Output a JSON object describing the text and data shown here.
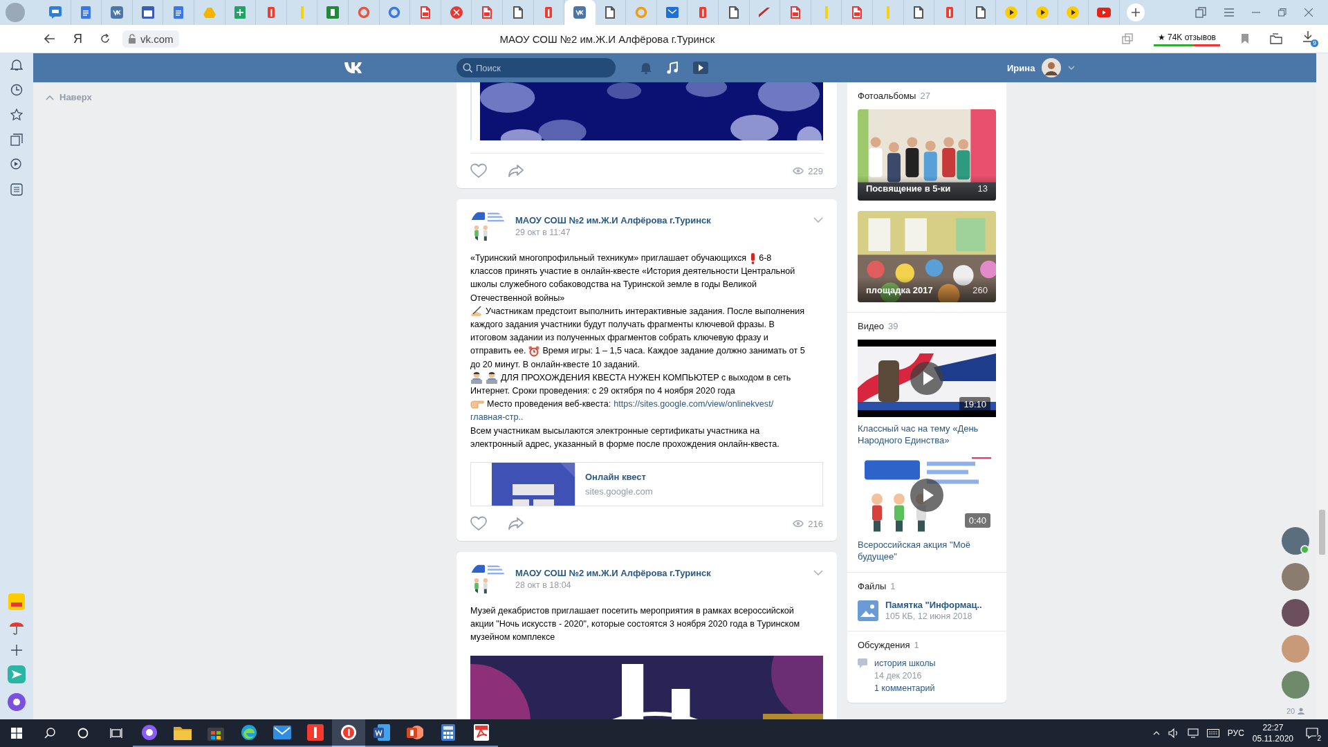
{
  "browser": {
    "tabs": [
      {
        "kind": "chat",
        "color": "#2a7de1",
        "selected": false
      },
      {
        "kind": "doc",
        "color": "#3b78e7",
        "selected": false
      },
      {
        "kind": "vk",
        "color": "#4a76a8",
        "selected": false
      },
      {
        "kind": "calendar",
        "color": "#3b5bb5",
        "selected": false
      },
      {
        "kind": "doc",
        "color": "#3b78e7",
        "selected": false
      },
      {
        "kind": "drive",
        "color": "#f4b400",
        "selected": false
      },
      {
        "kind": "sheet",
        "color": "#1fa463",
        "selected": false
      },
      {
        "kind": "yandex",
        "color": "#f33a2f",
        "selected": false
      },
      {
        "kind": "bar",
        "color": "#f5d10f",
        "selected": false
      },
      {
        "kind": "square",
        "color": "#1f8a3a",
        "selected": false
      },
      {
        "kind": "ring",
        "color": "#e8543c",
        "selected": false
      },
      {
        "kind": "ring",
        "color": "#3b78e7",
        "selected": false
      },
      {
        "kind": "pdf",
        "color": "#e53935",
        "selected": false
      },
      {
        "kind": "circle",
        "color": "#e53935",
        "selected": false
      },
      {
        "kind": "pdf",
        "color": "#e53935",
        "selected": false
      },
      {
        "kind": "page",
        "color": "#555555",
        "selected": false
      },
      {
        "kind": "yandex",
        "color": "#f33a2f",
        "selected": false
      },
      {
        "kind": "vk",
        "color": "#4a76a8",
        "selected": true
      },
      {
        "kind": "page",
        "color": "#555555",
        "selected": false
      },
      {
        "kind": "ring",
        "color": "#f39c12",
        "selected": false
      },
      {
        "kind": "mail",
        "color": "#1e6fd9",
        "selected": false
      },
      {
        "kind": "yandex",
        "color": "#f33a2f",
        "selected": false
      },
      {
        "kind": "page",
        "color": "#555555",
        "selected": false
      },
      {
        "kind": "slash",
        "color": "#c62828",
        "selected": false
      },
      {
        "kind": "pdf",
        "color": "#e53935",
        "selected": false
      },
      {
        "kind": "bar",
        "color": "#f5d10f",
        "selected": false
      },
      {
        "kind": "pdf",
        "color": "#e53935",
        "selected": false
      },
      {
        "kind": "bar",
        "color": "#f5d10f",
        "selected": false
      },
      {
        "kind": "page",
        "color": "#555555",
        "selected": false
      },
      {
        "kind": "yandex",
        "color": "#f33a2f",
        "selected": false
      },
      {
        "kind": "page",
        "color": "#555555",
        "selected": false
      },
      {
        "kind": "play",
        "color": "#ffcc00",
        "selected": false
      },
      {
        "kind": "play",
        "color": "#ffcc00",
        "selected": false
      },
      {
        "kind": "play",
        "color": "#ffcc00",
        "selected": false
      },
      {
        "kind": "youtube",
        "color": "#e62117",
        "selected": false
      }
    ],
    "address": "vk.com",
    "page_title": "МАОУ СОШ №2 им.Ж.И Алфёрова г.Туринск",
    "yandex_button": "Я",
    "reviews": "★ 74K отзывов",
    "downloads_badge": "9"
  },
  "vk_header": {
    "search_placeholder": "Поиск",
    "user_name": "Ирина"
  },
  "back_to_top": "Наверх",
  "posts": [
    {
      "kind": "partial",
      "attachment": {
        "kind": "picture"
      },
      "views": "229"
    },
    {
      "kind": "full",
      "author": "МАОУ СОШ №2 им.Ж.И Алфёрова г.Туринск",
      "date": "29 окт в 11:47",
      "lines": [
        [
          {
            "kind": "text",
            "text": "«Туринский многопрофильный техникум» приглашает обучающихся"
          },
          {
            "kind": "exclaim"
          },
          {
            "kind": "text",
            "text": "6-8"
          }
        ],
        [
          {
            "kind": "text",
            "text": "классов принять участие в онлайн-квесте «История деятельности Центральной"
          }
        ],
        [
          {
            "kind": "text",
            "text": "школы служебного собаководства на Туринской земле в годы Великой"
          }
        ],
        [
          {
            "kind": "text",
            "text": "Отечественной войны»"
          }
        ],
        [
          {
            "kind": "pen"
          },
          {
            "kind": "text",
            "text": "Участникам предстоит выполнить интерактивные задания. После выполнения"
          }
        ],
        [
          {
            "kind": "text",
            "text": "каждого задания участники будут получать фрагменты ключевой фразы. В"
          }
        ],
        [
          {
            "kind": "text",
            "text": "итоговом задании из полученных фрагментов собрать ключевую фразу и"
          }
        ],
        [
          {
            "kind": "text",
            "text": "отправить ее."
          },
          {
            "kind": "clock"
          },
          {
            "kind": "text",
            "text": "Время игры: 1 – 1,5 часа. Каждое задание должно занимать от 5"
          }
        ],
        [
          {
            "kind": "text",
            "text": "до 20 минут. В онлайн-квесте 10 заданий."
          }
        ],
        [
          {
            "kind": "coder"
          },
          {
            "kind": "coder"
          },
          {
            "kind": "text",
            "text": "ДЛЯ ПРОХОЖДЕНИЯ КВЕСТА НУЖЕН КОМПЬЮТЕР с выходом в сеть"
          }
        ],
        [
          {
            "kind": "text",
            "text": "Интернет. Сроки проведения: с 29 октября по 4 ноября 2020 года"
          }
        ],
        [
          {
            "kind": "point"
          },
          {
            "kind": "text",
            "text": "Место проведения веб-квеста:"
          },
          {
            "kind": "link",
            "text": "https://sites.google.com/view/onlinekvest/"
          }
        ],
        [
          {
            "kind": "link",
            "text": "главная-стр.."
          }
        ],
        [
          {
            "kind": "text",
            "text": "Всем участникам высылаются электронные сертификаты участника на"
          }
        ],
        [
          {
            "kind": "text",
            "text": "электронный адрес, указанный в форме после прохождения онлайн-квеста."
          }
        ]
      ],
      "link_card": {
        "title": "Онлайн квест",
        "domain": "sites.google.com"
      },
      "views": "216"
    },
    {
      "kind": "full",
      "author": "МАОУ СОШ №2 им.Ж.И Алфёрова г.Туринск",
      "date": "28 окт в 18:04",
      "lines": [
        [
          {
            "kind": "text",
            "text": "Музей декабристов приглашает посетить мероприятия в рамках всероссийской"
          }
        ],
        [
          {
            "kind": "text",
            "text": "акции \"Ночь искусств - 2020\", которые состоятся 3 ноября 2020 года в Туринском"
          }
        ],
        [
          {
            "kind": "text",
            "text": "музейном комплексе"
          }
        ]
      ],
      "attachment": {
        "kind": "picture"
      }
    }
  ],
  "sidebar": {
    "albums": {
      "title": "Фотоальбомы",
      "count": "27",
      "items": [
        {
          "title": "Посвящение в 5-ки",
          "count": "13"
        },
        {
          "title": "площадка 2017",
          "count": "260"
        }
      ]
    },
    "videos": {
      "title": "Видео",
      "count": "39",
      "items": [
        {
          "duration": "19:10",
          "title": "Классный час на тему «День Народного Единства»"
        },
        {
          "duration": "0:40",
          "title": "Всероссийская акция \"Моё будущее\""
        }
      ]
    },
    "files": {
      "title": "Файлы",
      "count": "1",
      "items": [
        {
          "name": "Памятка \"Информац..",
          "meta": "105 КБ, 12 июня 2018"
        }
      ]
    },
    "discussions": {
      "title": "Обсуждения",
      "count": "1",
      "items": [
        {
          "title": "история школы",
          "date": "14 дек 2016",
          "comments": "1 комментарий"
        }
      ]
    }
  },
  "online_friends": {
    "friends": [
      {
        "online": true
      },
      {
        "online": false
      },
      {
        "online": false
      },
      {
        "online": false
      },
      {
        "online": false
      }
    ],
    "count": "20"
  },
  "taskbar": {
    "apps": [
      {
        "kind": "alice",
        "color": "#8b5cf6",
        "selected": false
      },
      {
        "kind": "folder",
        "color": "#f4c542",
        "selected": false
      },
      {
        "kind": "store",
        "color": "#3f3f46",
        "selected": false
      },
      {
        "kind": "edge",
        "color": "#1fa0d8",
        "selected": false
      },
      {
        "kind": "mail",
        "color": "#2f8ee0",
        "selected": false
      },
      {
        "kind": "yandex",
        "color": "#f33a2f",
        "selected": false
      },
      {
        "kind": "ybrowser",
        "color": "#f33a2f",
        "selected": true
      },
      {
        "kind": "word",
        "color": "#2b579a",
        "selected": false
      },
      {
        "kind": "ppt",
        "color": "#d24726",
        "selected": false
      },
      {
        "kind": "calc",
        "color": "#3a7bd5",
        "selected": false
      },
      {
        "kind": "pdf",
        "color": "#e53935",
        "selected": false
      }
    ],
    "language": "РУС",
    "time": "22:27",
    "date": "05.11.2020",
    "notifications": "2"
  }
}
